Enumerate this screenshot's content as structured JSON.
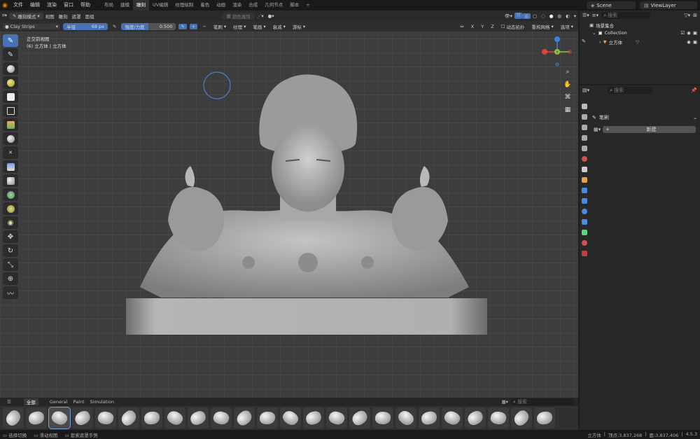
{
  "topbar": {
    "menu": [
      "文件",
      "编辑",
      "渲染",
      "窗口",
      "帮助"
    ],
    "workspaces": [
      "布局",
      "建模",
      "雕刻",
      "UV编辑",
      "纹理绘制",
      "着色",
      "动画",
      "渲染",
      "合成",
      "几何节点",
      "脚本"
    ],
    "active_workspace": "雕刻",
    "scene": "Scene",
    "view_layer": "ViewLayer"
  },
  "header1": {
    "mode": "雕刻模式",
    "menus": [
      "视图",
      "雕刻",
      "遮罩",
      "面组"
    ],
    "face_attr": "颜色属性",
    "view_options": [
      "X",
      "Y",
      "Z"
    ],
    "dyntopo": "动态拓扑",
    "remesh": "重构网格",
    "options": "选项"
  },
  "header2": {
    "brush_name": "Clay Strips",
    "radius_label": "半径",
    "radius_value": "68 px",
    "strength_label": "强度/力度",
    "strength_value": "0.500",
    "strength_fraction": 0.5,
    "menus": [
      "笔刷",
      "纹理",
      "笔画",
      "衰减",
      "游标"
    ]
  },
  "viewport": {
    "view_name": "正交前视图",
    "object_info": "(6) 立方体 | 立方体",
    "gizmo_axes": [
      "X",
      "Y",
      "Z"
    ]
  },
  "outliner": {
    "search_placeholder": "搜索",
    "root": "场景集合",
    "collection": "Collection",
    "object": "立方体"
  },
  "properties": {
    "search_placeholder": "搜索",
    "section": "笔刷",
    "new_button": "新建"
  },
  "asset_shelf": {
    "tabs": [
      "全部",
      "General",
      "Paint",
      "Simulation"
    ],
    "active_tab": "全部",
    "search_placeholder": "搜索",
    "brush_count": 24
  },
  "status": {
    "left": [
      "选择切换",
      "滑动视图",
      "套索遮罩手势"
    ],
    "object": "立方体",
    "verts": "顶点:3,837,268",
    "faces": "面:3,837,406",
    "version": "4.5.3"
  },
  "colors": {
    "accent": "#4772b3",
    "viewport": "#3d3d3d",
    "axis_x": "#e0413a",
    "axis_y": "#8cc63f",
    "axis_z": "#3e7fe0"
  }
}
